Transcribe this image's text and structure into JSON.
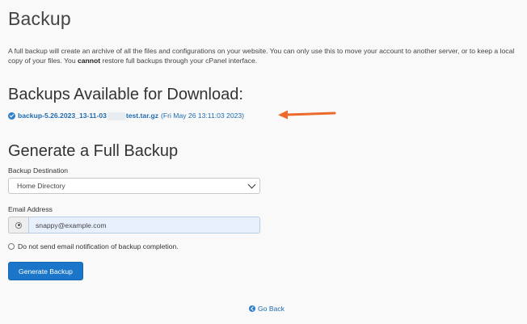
{
  "page": {
    "title": "Backup",
    "intro_part1": "A full backup will create an archive of all the files and configurations on your website. You can only use this to move your account to another server, or to keep a local copy of your files. You ",
    "intro_bold": "cannot",
    "intro_part2": " restore full backups through your cPanel interface."
  },
  "available": {
    "heading": "Backups Available for Download:",
    "file_prefix": "backup-5.26.2023_13-11-03",
    "file_suffix": "test.tar.gz",
    "file_date": "(Fri May 26 13:11:03 2023)"
  },
  "generate": {
    "heading": "Generate a Full Backup",
    "destination_label": "Backup Destination",
    "destination_value": "Home Directory",
    "email_label": "Email Address",
    "email_value": "snappy@example.com",
    "no_email_label": "Do not send email notification of backup completion.",
    "button_label": "Generate Backup"
  },
  "nav": {
    "go_back_label": "Go Back"
  },
  "colors": {
    "accent": "#1b76c9",
    "link": "#1e6bb0",
    "arrow": "#ee6a2a"
  },
  "icons": {
    "check": "check-circle-icon",
    "back": "back-circle-icon",
    "chevron": "chevron-down-icon",
    "annotation": "arrow-left-icon"
  }
}
